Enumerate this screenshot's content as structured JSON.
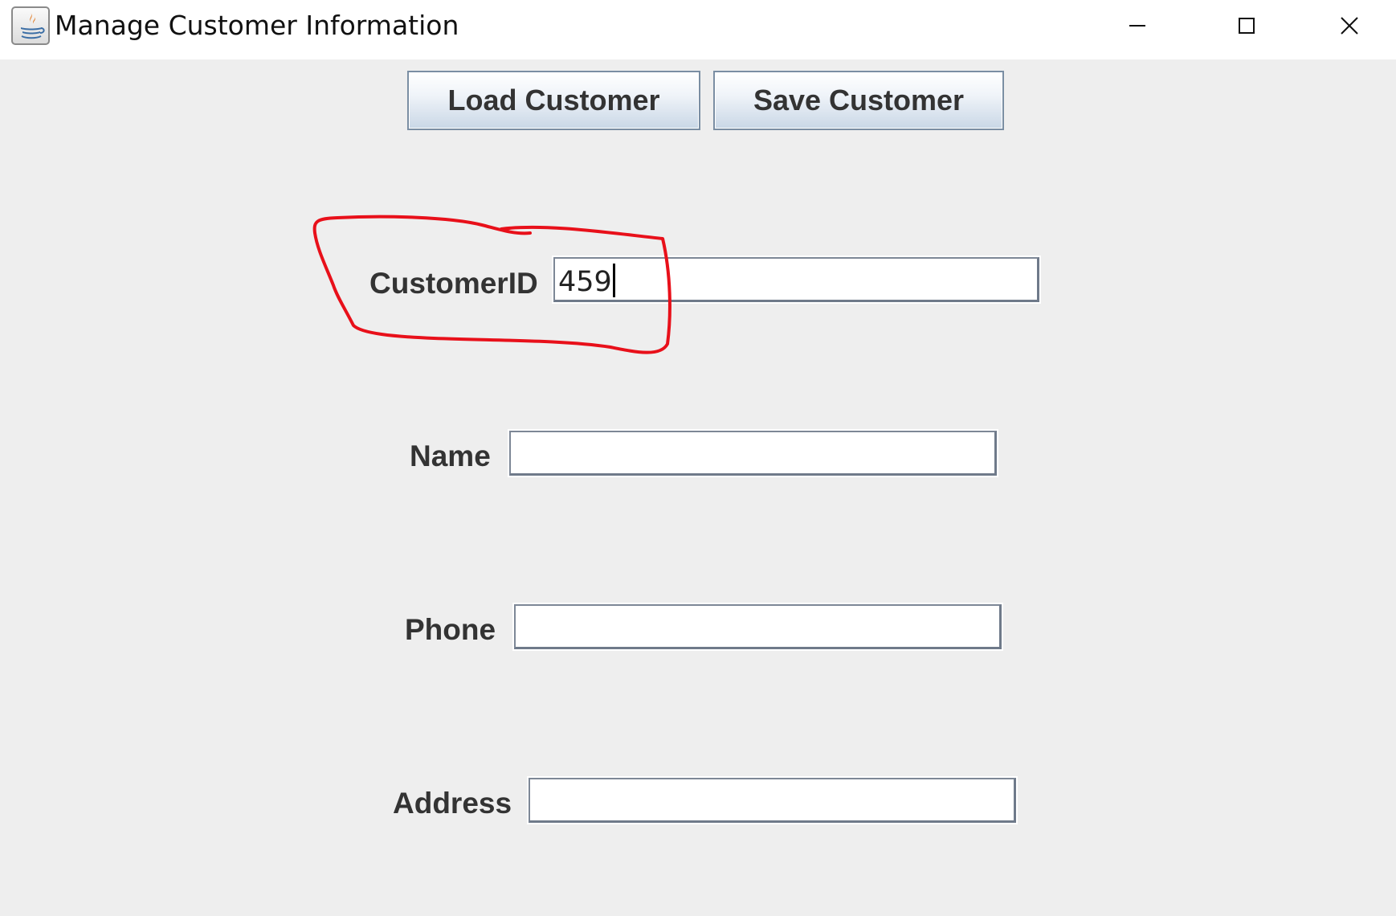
{
  "window": {
    "title": "Manage Customer Information",
    "app_icon": "java-coffee-icon",
    "controls": {
      "minimize_icon": "minimize-icon",
      "maximize_icon": "maximize-icon",
      "close_icon": "close-icon"
    }
  },
  "toolbar": {
    "load_label": "Load Customer",
    "save_label": "Save Customer"
  },
  "form": {
    "customer_id": {
      "label": "CustomerID",
      "value": "459"
    },
    "name": {
      "label": "Name",
      "value": ""
    },
    "phone": {
      "label": "Phone",
      "value": ""
    },
    "address": {
      "label": "Address",
      "value": ""
    }
  },
  "annotation": {
    "color": "#e8101a",
    "shape": "hand-drawn-loop"
  }
}
